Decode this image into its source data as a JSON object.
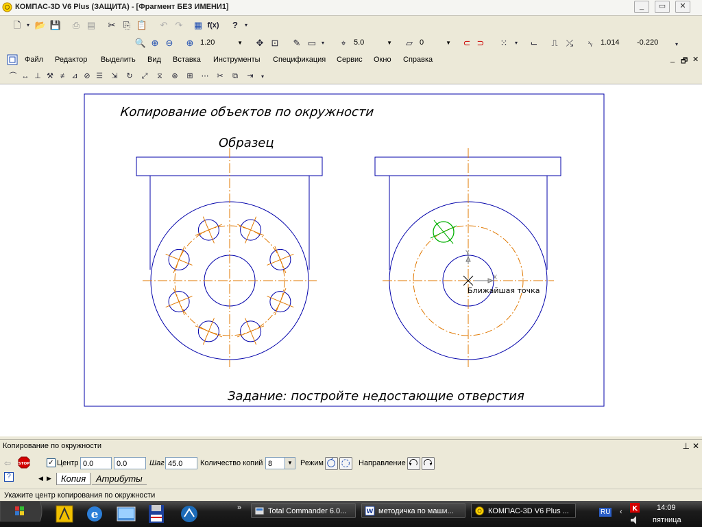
{
  "window": {
    "title": "КОМПАС-3D V6 Plus (ЗАЩИТА) - [Фрагмент БЕЗ ИМЕНИ1]"
  },
  "toolbar2": {
    "zoom": "1.20",
    "step": "5.0",
    "layer": "0",
    "coord_x": "1.014",
    "coord_y": "-0.220"
  },
  "menu": {
    "items": [
      "Файл",
      "Редактор",
      "Выделить",
      "Вид",
      "Вставка",
      "Инструменты",
      "Спецификация",
      "Сервис",
      "Окно",
      "Справка"
    ]
  },
  "drawing": {
    "heading": "Копирование объектов по окружности",
    "sample_label": "Образец",
    "task_label": "Задание: постройте недостающие отверстия",
    "snap_tooltip": "Ближайшая точка"
  },
  "panel": {
    "title": "Копирование по окружности",
    "center_label": "Центр",
    "center_x": "0.0",
    "center_y": "0.0",
    "step_label": "Шаг",
    "step_value": "45.0",
    "count_label": "Количество копий",
    "count_value": "8",
    "mode_label": "Режим",
    "direction_label": "Направление",
    "tabs": [
      "Копия",
      "Атрибуты"
    ]
  },
  "status": {
    "hint": "Укажите центр копирования по окружности"
  },
  "taskbar": {
    "tasks": [
      "Total Commander 6.0...",
      "методичка по маши...",
      "КОМПАС-3D V6 Plus ..."
    ],
    "lang": "RU",
    "time": "14:09",
    "day": "пятница"
  },
  "colors": {
    "contour": "#0000aa",
    "axis": "#e07800",
    "selection": "#00b000"
  }
}
